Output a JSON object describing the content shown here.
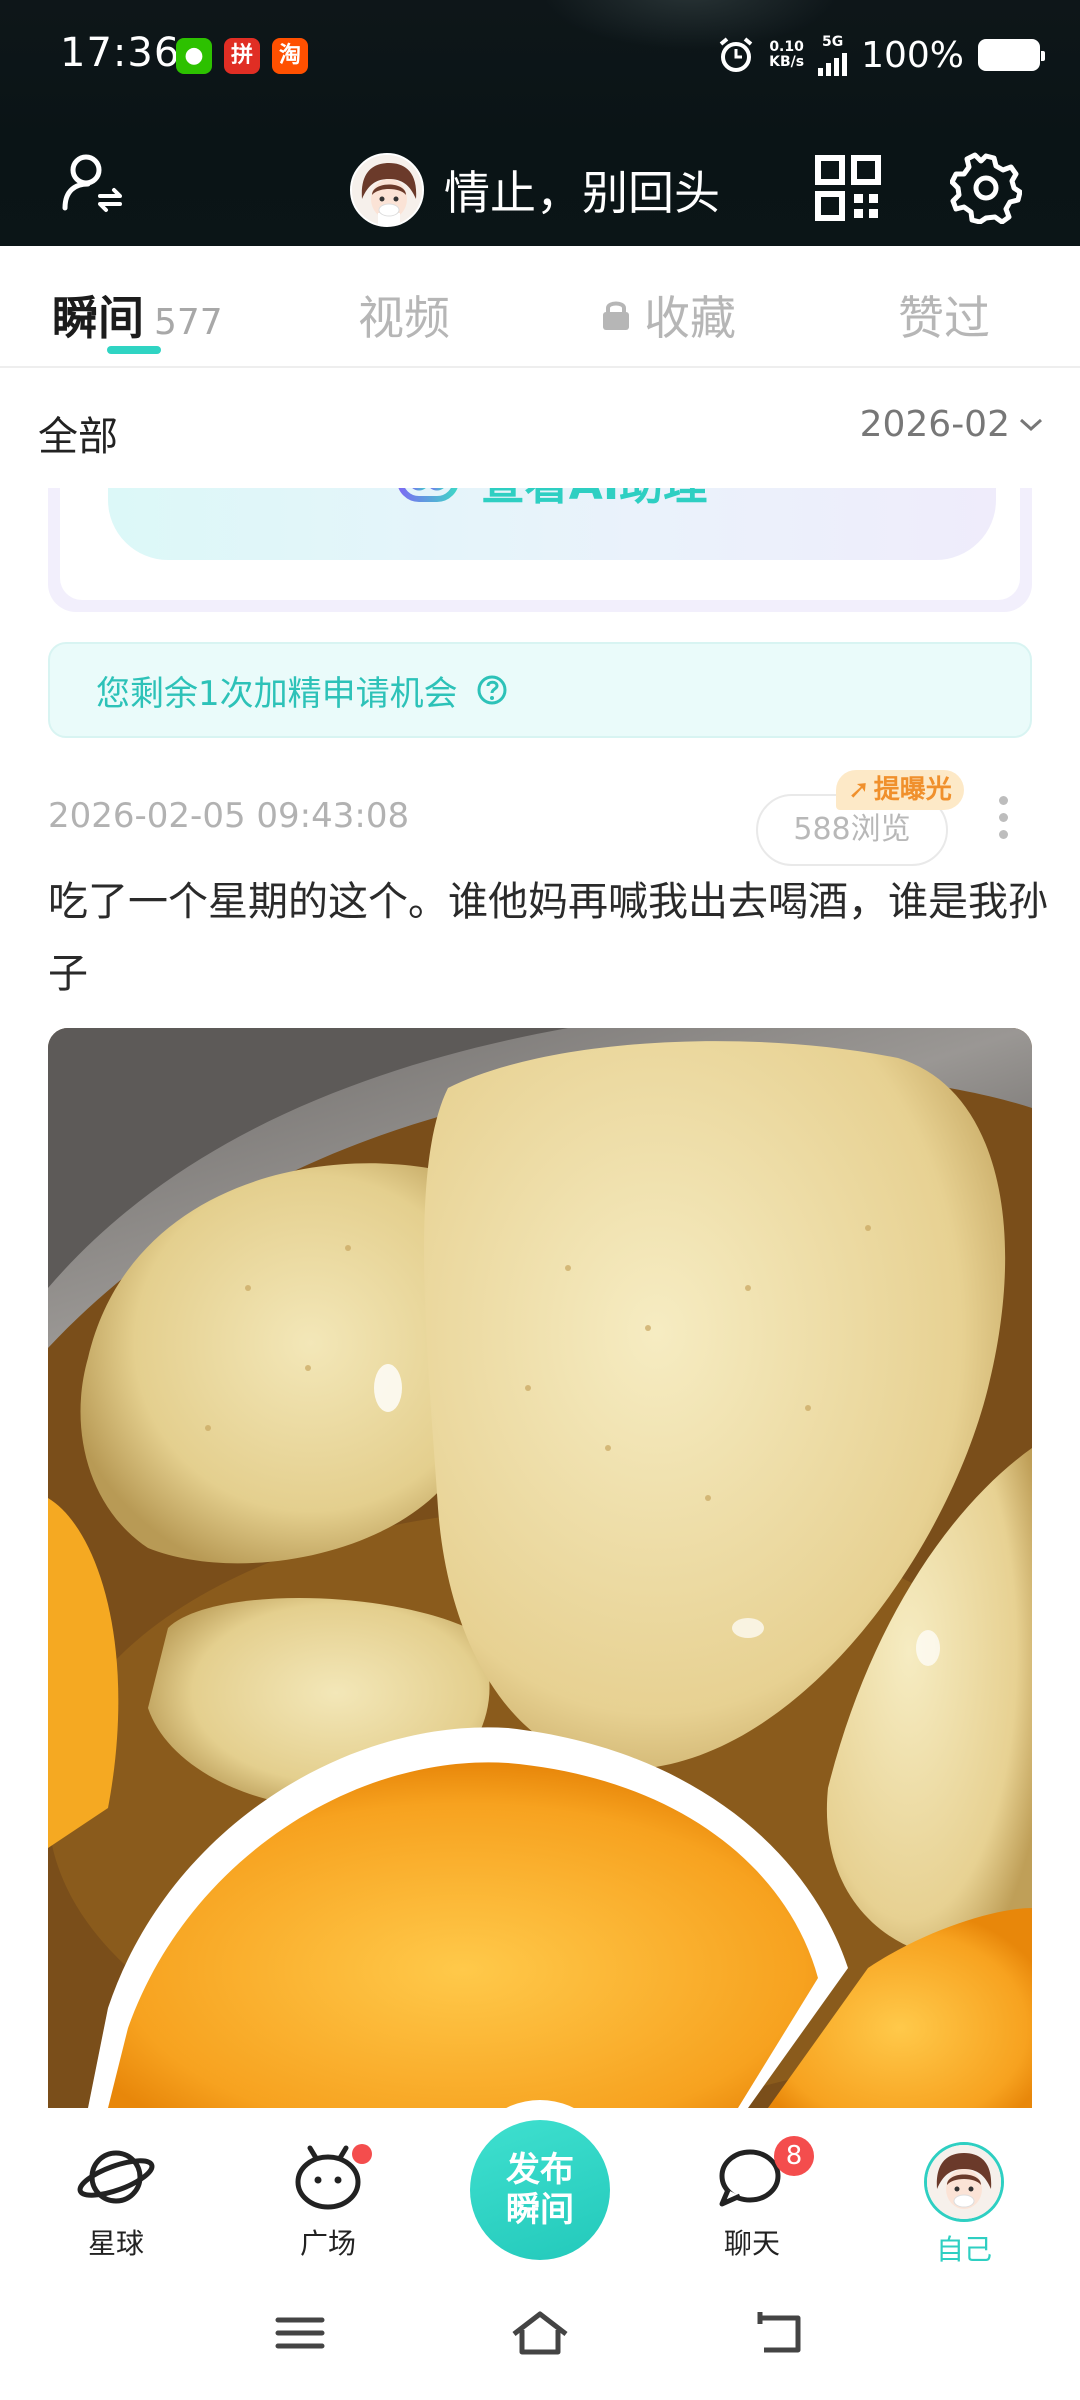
{
  "status_bar": {
    "time": "17:36",
    "net_speed_value": "0.10",
    "net_speed_unit": "KB/s",
    "network": "5G",
    "battery": "100%",
    "apps": [
      {
        "name": "wechat-icon",
        "color": "#2dc100"
      },
      {
        "name": "pinduoduo-icon",
        "color": "#e02e24"
      },
      {
        "name": "taobao-icon",
        "color": "#ff5000"
      }
    ]
  },
  "header": {
    "nickname": "情止，别回头",
    "icons": [
      "user-switch-icon",
      "qr-code-icon",
      "gear-icon"
    ]
  },
  "tabs": [
    {
      "label": "瞬间",
      "count": "577",
      "active": true
    },
    {
      "label": "视频"
    },
    {
      "label": "收藏",
      "locked": true
    },
    {
      "label": "赞过"
    }
  ],
  "filter": {
    "category": "全部",
    "date": "2026-02"
  },
  "ai_card": {
    "button_label": "查看AI助理"
  },
  "tip": {
    "text": "您剩余1次加精申请机会"
  },
  "post": {
    "time": "2026-02-05 09:43:08",
    "views": "588浏览",
    "exposure_tag": "提曝光",
    "text": "吃了一个星期的这个。谁他妈再喊我出去喝酒，谁是我孙子"
  },
  "bottom_nav": [
    {
      "label": "星球",
      "icon": "planet-icon"
    },
    {
      "label": "广场",
      "icon": "square-icon",
      "dot": true
    },
    {
      "label": "发布瞬间",
      "line1": "发布",
      "line2": "瞬间"
    },
    {
      "label": "聊天",
      "icon": "chat-icon",
      "badge": "8"
    },
    {
      "label": "自己",
      "icon": "avatar",
      "active": true
    }
  ],
  "colors": {
    "accent": "#2ecfc2",
    "header_bg": "#0b1517",
    "badge_red": "#f44d4d",
    "exposure_orange": "#f0902c"
  }
}
